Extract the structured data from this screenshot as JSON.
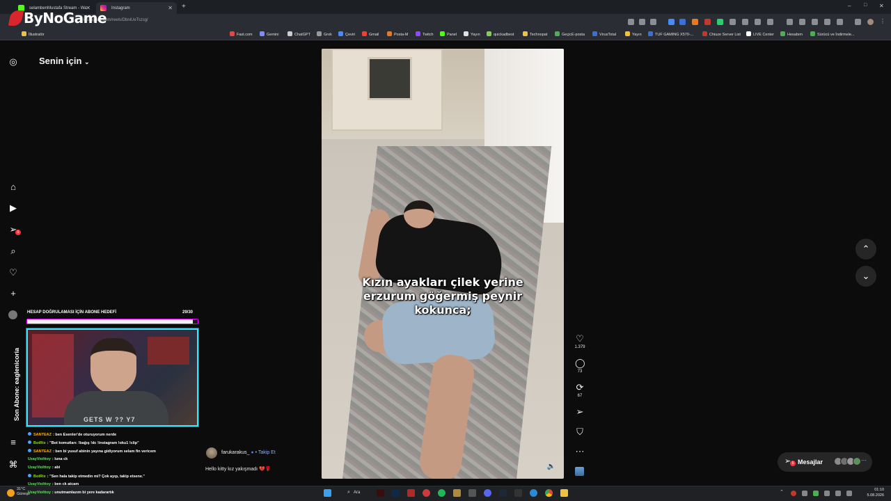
{
  "browser": {
    "tabs": [
      {
        "title": "selambenMustafa Stream - Wa",
        "active": false
      },
      {
        "title": "Instagram",
        "active": true
      }
    ],
    "url": "instagram.com/reels/DbniUeTszsg/",
    "bookmarks": [
      "İllustratör",
      "Fast.com",
      "Gemini",
      "ChatGPT",
      "Grok",
      "Çeviri",
      "Gmail",
      "Posta-M",
      "Twitch",
      "Panel",
      "Yayın",
      "quickadbest",
      "Technopat",
      "GeçicE-posta",
      "VirusTotal",
      "Yayın",
      "TUF GAMING X570-...",
      "Chiuze Server List",
      "LIVE Center",
      "Hesabım",
      "Sürücü ve İndirmele..."
    ]
  },
  "watermark": {
    "text": "ByNoGame"
  },
  "instagram": {
    "feed_title": "Senin için",
    "nav_badge": "5",
    "video": {
      "caption_overlay": "Kızın ayakları çilek yerine erzurum göğermiş peynir kokunca;"
    },
    "actions": {
      "likes": "1.379",
      "comments": "73",
      "reposts": "67"
    },
    "author": {
      "username": "farukarakus_",
      "follow_label": "Takip Et"
    },
    "post_caption": "Hello kitty kız yakışmadı 💔🌹",
    "messages": {
      "label": "Mesajlar",
      "badge": "5"
    }
  },
  "stream_overlay": {
    "goal_title": "HESAP DOĞRULAMASI İÇİN ABONE HEDEFİ",
    "goal_count": "29/30",
    "goal_progress": 0.97,
    "last_sub": "Son Abone: eaglenicoria",
    "cam_shirt_text": "GETS W ?? Y7",
    "chat": [
      {
        "user": "SANTEAZ",
        "text": ": ben Esenler'de oturuyorum nerde",
        "color": "#ffb000",
        "badge": true
      },
      {
        "user": "BotRix",
        "text": ": \"Bot komutları: !bağış !dc !instagram !oku1 !clip\"",
        "color": "#8be000",
        "badge": true
      },
      {
        "user": "SANTEAZ",
        "text": ": ben bi yusuf abinin yayına gidiyorum selam fin vericem",
        "color": "#ffb000",
        "badge": true
      },
      {
        "user": "UzayViolttoy",
        "text": ": luna ck",
        "color": "#5ee85e",
        "badge": false
      },
      {
        "user": "UzayViolttoy",
        "text": ": abi",
        "color": "#5ee85e",
        "badge": false
      },
      {
        "user": "BotRix",
        "text": ": \"Sen hala takip etmedin mi? Çok ayıp, takip etsene.\"",
        "color": "#8be000",
        "badge": true
      },
      {
        "user": "UzayViolttoy",
        "text": ": ben ck atcam",
        "color": "#5ee85e",
        "badge": false
      },
      {
        "user": "UzayViolttoy",
        "text": ": unutmamlazım bi yere kadarartık",
        "color": "#5ee85e",
        "badge": false
      }
    ]
  },
  "taskbar": {
    "search_label": "Ara",
    "weather": "31°C",
    "weather_sub": "Güneşli",
    "time": "01:10",
    "date": "5.08.2026"
  }
}
